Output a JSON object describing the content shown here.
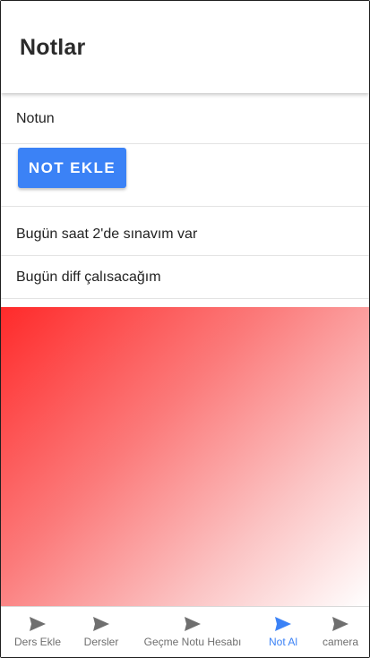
{
  "header": {
    "title": "Notlar"
  },
  "note_input": {
    "placeholder": "Notun"
  },
  "add_button": {
    "label": "NOT EKLE"
  },
  "notes": [
    {
      "text": "Bugün saat 2'de sınavım var"
    },
    {
      "text": "Bugün diff çalısacağım"
    }
  ],
  "colors": {
    "accent": "#3b82f6",
    "gradient_start": "#ff2a2a",
    "gradient_end": "#ffffff",
    "tab_inactive": "#6f6f6f"
  },
  "tabs": [
    {
      "label": "Ders Ekle",
      "icon": "send-icon",
      "active": false
    },
    {
      "label": "Dersler",
      "icon": "send-icon",
      "active": false
    },
    {
      "label": "Geçme Notu Hesabı",
      "icon": "send-icon",
      "active": false
    },
    {
      "label": "Not Al",
      "icon": "send-icon",
      "active": true
    },
    {
      "label": "camera",
      "icon": "send-icon",
      "active": false
    }
  ]
}
